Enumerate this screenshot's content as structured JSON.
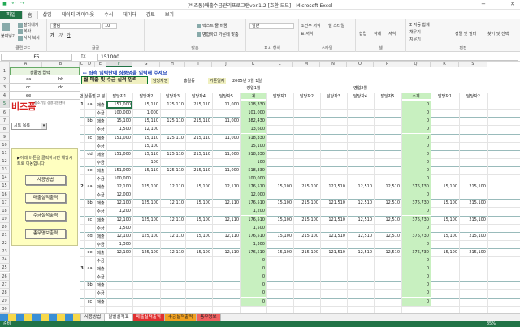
{
  "window": {
    "title": "(비즈폼)매출수금관리프로그램ver.1.2 [호환 모드] - Microsoft Excel",
    "quick_access": [
      "save-icon",
      "undo-icon",
      "redo-icon"
    ],
    "controls": [
      "−",
      "□",
      "✕"
    ]
  },
  "ribbon_tabs": [
    "파일",
    "홈",
    "삽입",
    "페이지 레이아웃",
    "수식",
    "데이터",
    "검토",
    "보기"
  ],
  "ribbon": {
    "clipboard": {
      "label": "클립보드",
      "paste": "붙여넣기",
      "cut": "잘라내기",
      "copy": "복사",
      "format_painter": "서식 복사"
    },
    "font": {
      "label": "글꼴",
      "name": "굴림",
      "size": "10",
      "bold": "가",
      "italic": "가",
      "underline": "가"
    },
    "alignment": {
      "label": "맞춤",
      "wrap": "텍스트 줄 바꿈",
      "merge": "병합하고 가운데 맞춤"
    },
    "number": {
      "label": "표시 형식",
      "format": "일반"
    },
    "styles": {
      "label": "스타일",
      "cond": "조건부 서식",
      "table": "표 서식",
      "cell": "셀 스타일"
    },
    "cells": {
      "label": "셀",
      "insert": "삽입",
      "delete": "삭제",
      "format": "서식"
    },
    "editing": {
      "label": "편집",
      "sum": "Σ 자동 합계",
      "fill": "채우기",
      "clear": "지우기",
      "sort": "정렬 및 필터",
      "find": "찾기 및 선택"
    }
  },
  "formula_bar": {
    "name_box": "F5",
    "fx": "fx",
    "value": "151000"
  },
  "columns": [
    "A",
    "B",
    "C",
    "D",
    "E",
    "F",
    "G",
    "H",
    "I",
    "J",
    "K",
    "L",
    "M",
    "N",
    "O",
    "P",
    "Q",
    "R",
    "S"
  ],
  "left_panel": {
    "header": "상품명 입력",
    "items": [
      [
        "aa",
        "bb"
      ],
      [
        "cc",
        "dd"
      ],
      [
        "ee",
        ""
      ]
    ],
    "logo": "비즈폼",
    "logo_sub": "중소기업 경영지원센터",
    "select": "시트 목록",
    "note": "▶아래 버튼을 클릭하시면 해당시트로 이동합니다.",
    "buttons": [
      "사용방법",
      "매출실적출력",
      "수금실적출력",
      "총무명보출력"
    ]
  },
  "main": {
    "instruction": "← 좌측 입력란에 상품명을 입력해 주세요",
    "section_title": "월 매출 및 수금 실적 입력",
    "meta": [
      "담당자명",
      "홍길동",
      "기준일자",
      "2005년 3월 1일"
    ],
    "month1": "영업1월",
    "month2": "영업2월",
    "headers": [
      "번호",
      "상품명",
      "구 분",
      "담당자1",
      "담당자2",
      "담당자3",
      "담당자4",
      "담당자5",
      "계",
      "담당자1",
      "담당자2",
      "담당자3",
      "담당자4",
      "담당자5",
      "소계",
      "담당자1",
      "담당자2"
    ],
    "rows": [
      [
        "1",
        "aa",
        "매출",
        "151,000",
        "15,110",
        "125,110",
        "215,110",
        "11,000",
        "518,330",
        "",
        "",
        "",
        "",
        "",
        "0",
        "",
        ""
      ],
      [
        "",
        "",
        "수금",
        "100,000",
        "1,000",
        "",
        "",
        "",
        "101,000",
        "",
        "",
        "",
        "",
        "",
        "0",
        "",
        ""
      ],
      [
        "",
        "bb",
        "매출",
        "15,100",
        "15,110",
        "125,110",
        "215,110",
        "11,000",
        "382,430",
        "",
        "",
        "",
        "",
        "",
        "0",
        "",
        ""
      ],
      [
        "",
        "",
        "수금",
        "1,500",
        "12,100",
        "",
        "",
        "",
        "13,600",
        "",
        "",
        "",
        "",
        "",
        "0",
        "",
        ""
      ],
      [
        "",
        "cc",
        "매출",
        "151,000",
        "15,110",
        "125,110",
        "215,110",
        "11,000",
        "518,330",
        "",
        "",
        "",
        "",
        "",
        "0",
        "",
        ""
      ],
      [
        "",
        "",
        "수금",
        "",
        "15,100",
        "",
        "",
        "",
        "15,100",
        "",
        "",
        "",
        "",
        "",
        "0",
        "",
        ""
      ],
      [
        "",
        "dd",
        "매출",
        "151,000",
        "15,110",
        "125,110",
        "215,110",
        "11,000",
        "518,330",
        "",
        "",
        "",
        "",
        "",
        "0",
        "",
        ""
      ],
      [
        "",
        "",
        "수금",
        "",
        "100",
        "",
        "",
        "",
        "100",
        "",
        "",
        "",
        "",
        "",
        "0",
        "",
        ""
      ],
      [
        "",
        "ee",
        "매출",
        "151,000",
        "15,110",
        "125,110",
        "215,110",
        "11,000",
        "518,330",
        "",
        "",
        "",
        "",
        "",
        "0",
        "",
        ""
      ],
      [
        "",
        "",
        "수금",
        "100,000",
        "",
        "",
        "",
        "",
        "100,000",
        "",
        "",
        "",
        "",
        "",
        "0",
        "",
        ""
      ],
      [
        "2",
        "aa",
        "매출",
        "12,100",
        "125,100",
        "12,110",
        "15,100",
        "12,110",
        "176,510",
        "15,100",
        "215,100",
        "121,510",
        "12,510",
        "12,510",
        "376,730",
        "15,100",
        "215,100"
      ],
      [
        "",
        "",
        "수금",
        "12,000",
        "",
        "",
        "",
        "",
        "12,000",
        "",
        "",
        "",
        "",
        "",
        "0",
        "",
        ""
      ],
      [
        "",
        "bb",
        "매출",
        "12,100",
        "125,100",
        "12,110",
        "15,100",
        "12,110",
        "176,510",
        "15,100",
        "215,100",
        "121,510",
        "12,510",
        "12,510",
        "376,730",
        "15,100",
        "215,100"
      ],
      [
        "",
        "",
        "수금",
        "1,200",
        "",
        "",
        "",
        "",
        "1,200",
        "",
        "",
        "",
        "",
        "",
        "0",
        "",
        ""
      ],
      [
        "",
        "cc",
        "매출",
        "12,100",
        "125,100",
        "12,110",
        "15,100",
        "12,110",
        "176,510",
        "15,100",
        "215,100",
        "121,510",
        "12,510",
        "12,510",
        "376,730",
        "15,100",
        "215,100"
      ],
      [
        "",
        "",
        "수금",
        "1,500",
        "",
        "",
        "",
        "",
        "1,500",
        "",
        "",
        "",
        "",
        "",
        "0",
        "",
        ""
      ],
      [
        "",
        "dd",
        "매출",
        "12,100",
        "125,100",
        "12,110",
        "15,100",
        "12,110",
        "176,510",
        "15,100",
        "215,100",
        "121,510",
        "12,510",
        "12,510",
        "376,730",
        "15,100",
        "215,100"
      ],
      [
        "",
        "",
        "수금",
        "1,300",
        "",
        "",
        "",
        "",
        "1,300",
        "",
        "",
        "",
        "",
        "",
        "0",
        "",
        ""
      ],
      [
        "",
        "ee",
        "매출",
        "12,100",
        "125,100",
        "12,110",
        "15,100",
        "12,110",
        "176,510",
        "15,100",
        "215,100",
        "121,510",
        "12,510",
        "12,510",
        "376,730",
        "15,100",
        "215,100"
      ],
      [
        "",
        "",
        "수금",
        "",
        "",
        "",
        "",
        "",
        "0",
        "",
        "",
        "",
        "",
        "",
        "0",
        "",
        ""
      ],
      [
        "3",
        "aa",
        "매출",
        "",
        "",
        "",
        "",
        "",
        "0",
        "",
        "",
        "",
        "",
        "",
        "0",
        "",
        ""
      ],
      [
        "",
        "",
        "수금",
        "",
        "",
        "",
        "",
        "",
        "0",
        "",
        "",
        "",
        "",
        "",
        "0",
        "",
        ""
      ],
      [
        "",
        "bb",
        "매출",
        "",
        "",
        "",
        "",
        "",
        "0",
        "",
        "",
        "",
        "",
        "",
        "0",
        "",
        ""
      ],
      [
        "",
        "",
        "수금",
        "",
        "",
        "",
        "",
        "",
        "0",
        "",
        "",
        "",
        "",
        "",
        "0",
        "",
        ""
      ],
      [
        "",
        "cc",
        "매출",
        "",
        "",
        "",
        "",
        "",
        "0",
        "",
        "",
        "",
        "",
        "",
        "0",
        "",
        ""
      ],
      [
        "",
        "",
        "수금",
        "",
        "",
        "",
        "",
        "",
        "0",
        "",
        "",
        "",
        "",
        "",
        "0",
        "",
        ""
      ],
      [
        "",
        "dd",
        "매출",
        "",
        "",
        "",
        "",
        "",
        "0",
        "",
        "",
        "",
        "",
        "",
        "0",
        "",
        ""
      ],
      [
        "",
        "",
        "수금",
        "",
        "",
        "",
        "",
        "",
        "0",
        "",
        "",
        "",
        "",
        "",
        "0",
        "",
        ""
      ],
      [
        "",
        "ee",
        "매출",
        "",
        "",
        "",
        "",
        "",
        "0",
        "",
        "",
        "",
        "",
        "",
        "0",
        "",
        ""
      ],
      [
        "",
        "",
        "수금",
        "",
        "",
        "",
        "",
        "",
        "0",
        "",
        "",
        "",
        "",
        "",
        "0",
        "",
        ""
      ]
    ]
  },
  "sheet_tabs": [
    "사용방법",
    "월별실적표",
    "매출실적출력",
    "수금실적출력",
    "총무명보"
  ],
  "status": {
    "ready": "준비",
    "zoom": "85%"
  }
}
